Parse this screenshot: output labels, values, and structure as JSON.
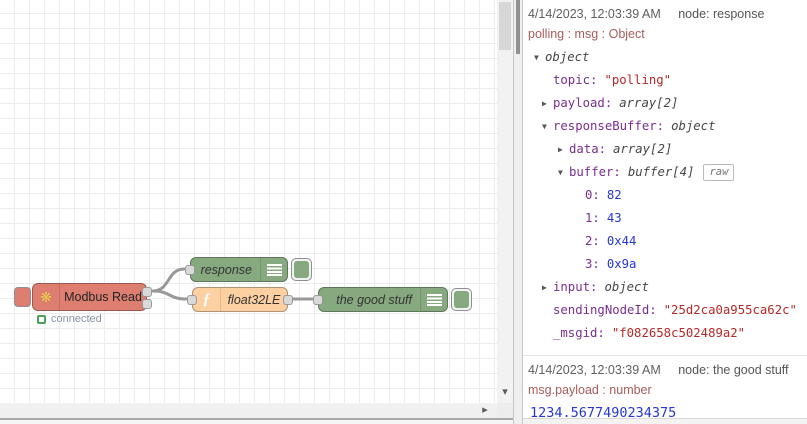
{
  "ui": {
    "icons": {
      "scroll_down": "▾",
      "scroll_right": "▸"
    }
  },
  "canvas": {
    "nodes": {
      "modbus": {
        "label": "Modbus Read",
        "icon": "❋",
        "color": "#dd7e71",
        "status": "connected"
      },
      "response": {
        "label": "response",
        "color": "#87a980"
      },
      "float32le": {
        "label": "float32LE",
        "icon": "ƒ",
        "color": "#fdd0a2"
      },
      "goodstuff": {
        "label": "the good stuff",
        "color": "#87a980"
      }
    }
  },
  "sidebar": {
    "messages": [
      {
        "timestamp": "4/14/2023, 12:03:39 AM",
        "source": "node: response",
        "meta": "polling : msg : Object",
        "rows": [
          {
            "arrow": "▼",
            "type": "object"
          },
          {
            "key": "topic",
            "value": "\"polling\""
          },
          {
            "arrow": "▶",
            "key": "payload",
            "type": "array[2]"
          },
          {
            "arrow": "▼",
            "key": "responseBuffer",
            "type": "object"
          },
          {
            "arrow": "▶",
            "key": "data",
            "type": "array[2]"
          },
          {
            "arrow": "▼",
            "key": "buffer",
            "type": "buffer[4]",
            "badge": "raw"
          },
          {
            "key": "0",
            "value": "82"
          },
          {
            "key": "1",
            "value": "43"
          },
          {
            "key": "2",
            "value": "0x44"
          },
          {
            "key": "3",
            "value": "0x9a"
          },
          {
            "arrow": "▶",
            "key": "input",
            "type": "object"
          },
          {
            "key": "sendingNodeId",
            "value": "\"25d2ca0a955ca62c\""
          },
          {
            "key": "_msgid",
            "value": "\"f082658c502489a2\""
          }
        ]
      },
      {
        "timestamp": "4/14/2023, 12:03:39 AM",
        "source": "node: the good stuff",
        "meta": "msg.payload : number",
        "value": "1234.5677490234375"
      }
    ]
  }
}
